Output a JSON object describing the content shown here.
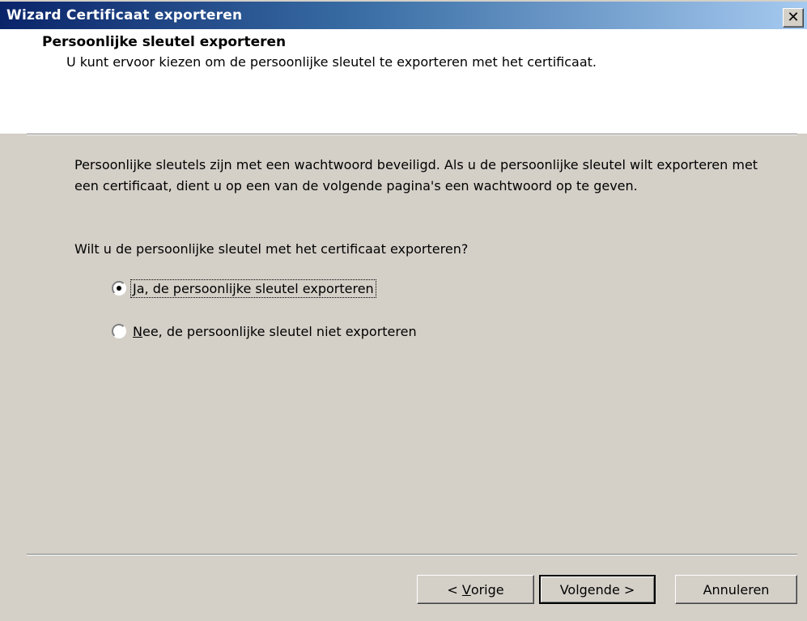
{
  "window": {
    "title": "Wizard Certificaat exporteren",
    "close_glyph": "✕"
  },
  "header": {
    "title": "Persoonlijke sleutel exporteren",
    "subtitle": "U kunt ervoor kiezen om de persoonlijke sleutel te exporteren met het certificaat."
  },
  "body": {
    "description": "Persoonlijke sleutels zijn met een wachtwoord beveiligd. Als u de persoonlijke sleutel wilt exporteren met een certificaat, dient u op een van de volgende pagina's een wachtwoord op te geven.",
    "question": "Wilt u de persoonlijke sleutel met het certificaat exporteren?"
  },
  "options": [
    {
      "mnemonic": "J",
      "rest": "a, de persoonlijke sleutel exporteren",
      "selected": true
    },
    {
      "mnemonic": "N",
      "rest": "ee, de persoonlijke sleutel niet exporteren",
      "selected": false
    }
  ],
  "buttons": {
    "back_prefix": "< ",
    "back_mnemonic": "V",
    "back_rest": "orige",
    "next": "Volgende >",
    "cancel": "Annuleren"
  },
  "colors": {
    "titlebar_start": "#0a246a",
    "titlebar_end": "#a6caf0",
    "dialog_bg": "#d4d0c8",
    "header_bg": "#ffffff"
  }
}
